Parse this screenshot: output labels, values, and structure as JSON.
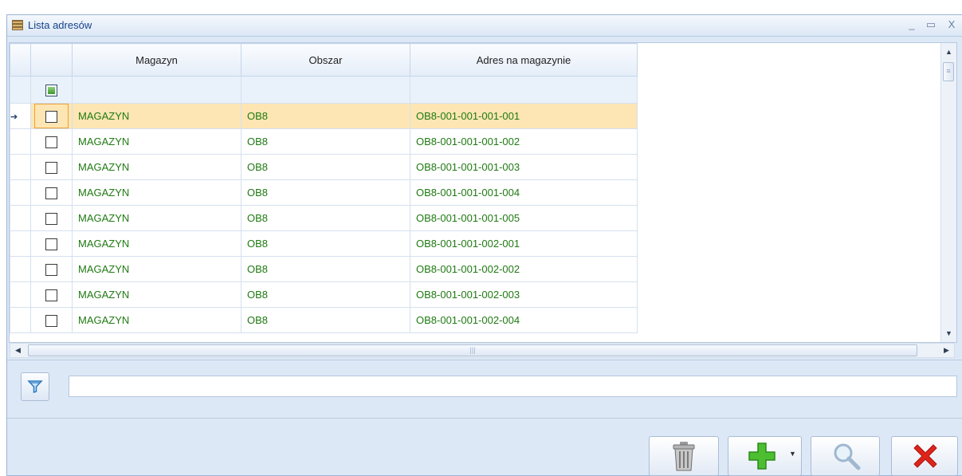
{
  "window": {
    "title": "Lista adresów"
  },
  "grid": {
    "columns": [
      "Magazyn",
      "Obszar",
      "Adres na magazynie"
    ],
    "rows": [
      {
        "magazyn": "MAGAZYN",
        "obszar": "OB8",
        "adres": "OB8-001-001-001-001",
        "selected": true
      },
      {
        "magazyn": "MAGAZYN",
        "obszar": "OB8",
        "adres": "OB8-001-001-001-002"
      },
      {
        "magazyn": "MAGAZYN",
        "obszar": "OB8",
        "adres": "OB8-001-001-001-003"
      },
      {
        "magazyn": "MAGAZYN",
        "obszar": "OB8",
        "adres": "OB8-001-001-001-004"
      },
      {
        "magazyn": "MAGAZYN",
        "obszar": "OB8",
        "adres": "OB8-001-001-001-005"
      },
      {
        "magazyn": "MAGAZYN",
        "obszar": "OB8",
        "adres": "OB8-001-001-002-001"
      },
      {
        "magazyn": "MAGAZYN",
        "obszar": "OB8",
        "adres": "OB8-001-001-002-002"
      },
      {
        "magazyn": "MAGAZYN",
        "obszar": "OB8",
        "adres": "OB8-001-001-002-003"
      },
      {
        "magazyn": "MAGAZYN",
        "obszar": "OB8",
        "adres": "OB8-001-001-002-004"
      }
    ]
  },
  "filter": {
    "value": ""
  },
  "colors": {
    "text_green": "#1f7a12",
    "selected_row": "#fde6b4",
    "delete_red": "#e0241b",
    "add_green": "#3fb02a"
  },
  "icons": {
    "filter": "funnel-icon",
    "delete": "trash-icon",
    "add": "plus-icon",
    "search": "magnifier-icon",
    "close": "x-icon"
  }
}
